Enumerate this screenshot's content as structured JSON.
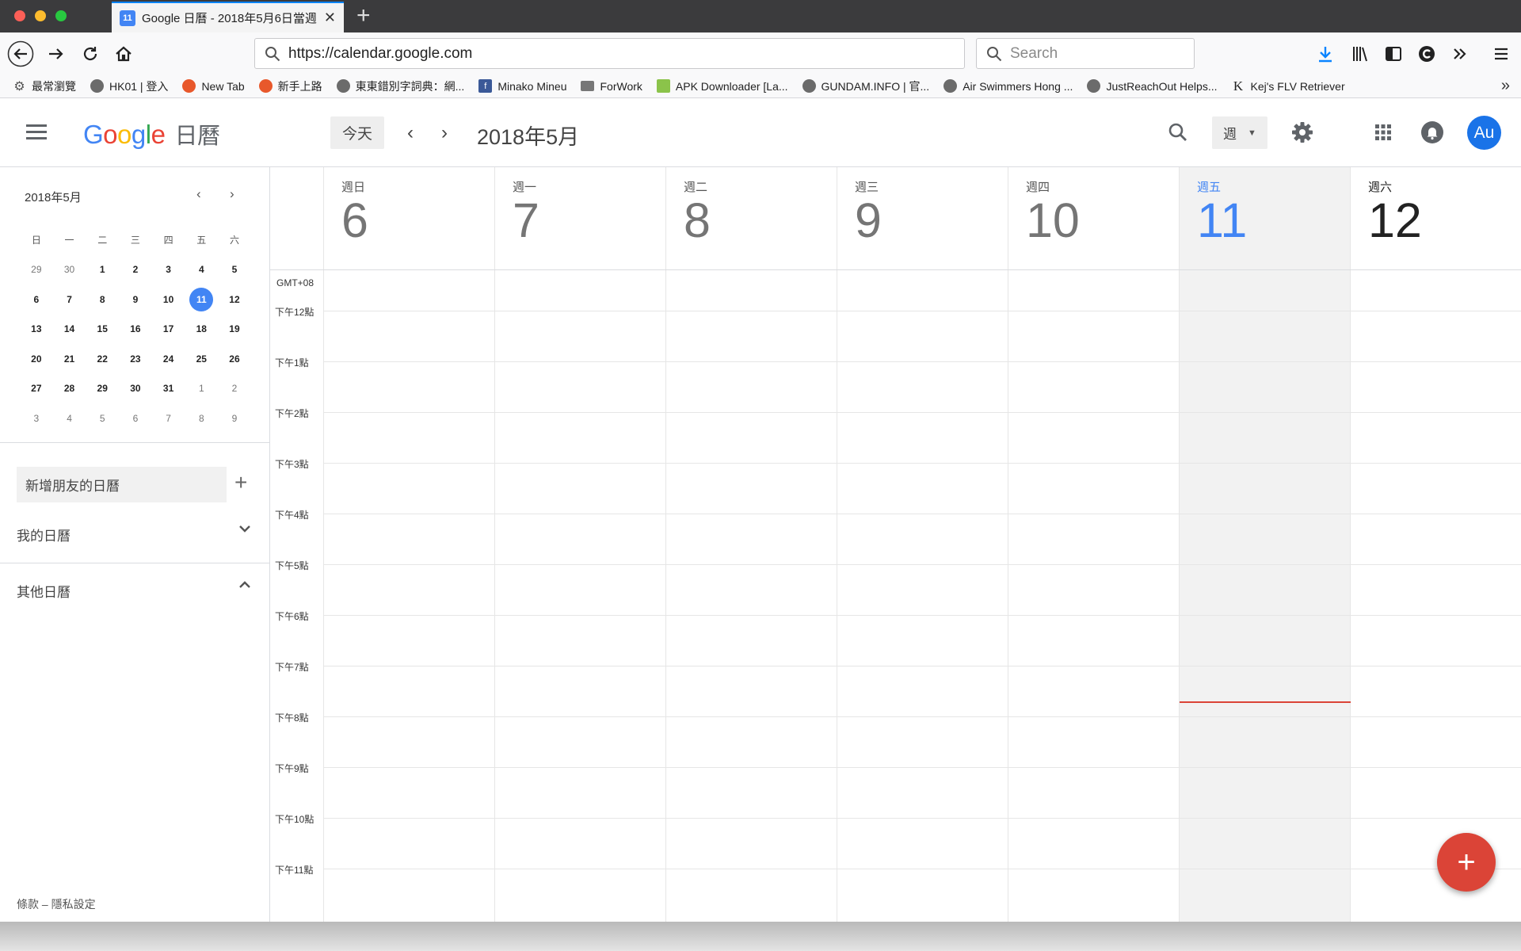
{
  "browser": {
    "tab_title": "Google 日曆 - 2018年5月6日當週",
    "tab_favicon_text": "11",
    "new_tab_label": "+",
    "url": "https://calendar.google.com",
    "search_placeholder": "Search",
    "bookmarks": [
      {
        "label": "最常瀏覽",
        "icon": "gear-icon",
        "color": "#555555"
      },
      {
        "label": "HK01 | 登入",
        "icon": "globe-icon",
        "color": "#6b6b6b"
      },
      {
        "label": "New Tab",
        "icon": "firefox-icon",
        "color": "#e8582b"
      },
      {
        "label": "新手上路",
        "icon": "firefox-icon",
        "color": "#e8582b"
      },
      {
        "label": "東東錯別字詞典：網...",
        "icon": "globe-icon",
        "color": "#6b6b6b"
      },
      {
        "label": "Minako Mineu",
        "icon": "facebook-icon",
        "color": "#3b5998"
      },
      {
        "label": "ForWork",
        "icon": "folder-icon",
        "color": "#777777"
      },
      {
        "label": "APK Downloader [La...",
        "icon": "android-icon",
        "color": "#8bc34a"
      },
      {
        "label": "GUNDAM.INFO | 官...",
        "icon": "globe-icon",
        "color": "#6b6b6b"
      },
      {
        "label": "Air Swimmers Hong ...",
        "icon": "globe-icon",
        "color": "#6b6b6b"
      },
      {
        "label": "JustReachOut Helps...",
        "icon": "globe-icon",
        "color": "#6b6b6b"
      },
      {
        "label": "Kej's FLV Retriever",
        "icon": "k-icon",
        "color": "#222222"
      }
    ]
  },
  "calendar": {
    "product_name": "日曆",
    "today_button": "今天",
    "current_range": "2018年5月",
    "view_selector": "週",
    "avatar_initials": "Au",
    "accent_color": "#4285f4",
    "now_line_color": "#db4437",
    "create_button": "+"
  },
  "mini_calendar": {
    "title": "2018年5月",
    "weekday_headers": [
      "日",
      "一",
      "二",
      "三",
      "四",
      "五",
      "六"
    ],
    "weeks": [
      [
        "29",
        "30",
        "1",
        "2",
        "3",
        "4",
        "5"
      ],
      [
        "6",
        "7",
        "8",
        "9",
        "10",
        "11",
        "12"
      ],
      [
        "13",
        "14",
        "15",
        "16",
        "17",
        "18",
        "19"
      ],
      [
        "20",
        "21",
        "22",
        "23",
        "24",
        "25",
        "26"
      ],
      [
        "27",
        "28",
        "29",
        "30",
        "31",
        "1",
        "2"
      ],
      [
        "3",
        "4",
        "5",
        "6",
        "7",
        "8",
        "9"
      ]
    ],
    "dim_cells": [
      [
        0,
        0
      ],
      [
        0,
        1
      ],
      [
        4,
        5
      ],
      [
        4,
        6
      ],
      [
        5,
        0
      ],
      [
        5,
        1
      ],
      [
        5,
        2
      ],
      [
        5,
        3
      ],
      [
        5,
        4
      ],
      [
        5,
        5
      ],
      [
        5,
        6
      ]
    ],
    "selected_cell": [
      1,
      5
    ]
  },
  "sidebar": {
    "add_friend_placeholder": "新增朋友的日曆",
    "my_calendars": "我的日曆",
    "other_calendars": "其他日曆",
    "footer": "條款 – 隱私設定"
  },
  "week": {
    "timezone": "GMT+08",
    "days": [
      {
        "dow": "週日",
        "num": "6"
      },
      {
        "dow": "週一",
        "num": "7"
      },
      {
        "dow": "週二",
        "num": "8"
      },
      {
        "dow": "週三",
        "num": "9"
      },
      {
        "dow": "週四",
        "num": "10"
      },
      {
        "dow": "週五",
        "num": "11",
        "today": true
      },
      {
        "dow": "週六",
        "num": "12"
      }
    ],
    "hours": [
      "下午12點",
      "下午1點",
      "下午2點",
      "下午3點",
      "下午4點",
      "下午5點",
      "下午6點",
      "下午7點",
      "下午8點",
      "下午9點",
      "下午10點",
      "下午11點"
    ]
  }
}
